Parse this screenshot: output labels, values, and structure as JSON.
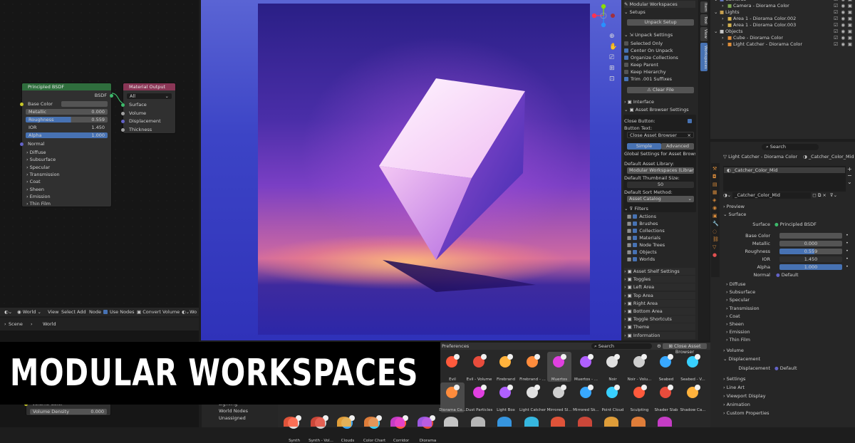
{
  "node_editor": {
    "principled": {
      "title": "Principled BSDF",
      "out": "BSDF",
      "base_color": "Base Color",
      "metallic": "Metallic",
      "metallic_v": "0.000",
      "roughness": "Roughness",
      "roughness_v": "0.559",
      "ior": "IOR",
      "ior_v": "1.450",
      "alpha": "Alpha",
      "alpha_v": "1.000",
      "normal": "Normal",
      "panels": [
        "Diffuse",
        "Subsurface",
        "Specular",
        "Transmission",
        "Coat",
        "Sheen",
        "Emission",
        "Thin Film"
      ]
    },
    "output": {
      "title": "Material Output",
      "target": "All",
      "inputs": [
        "Surface",
        "Volume",
        "Displacement",
        "Thickness"
      ]
    }
  },
  "shader_header": {
    "world": "World",
    "menus": [
      "View",
      "Select",
      "Add",
      "Node"
    ],
    "use_nodes": "Use Nodes",
    "convert": "Convert Volume",
    "wo": "Wo"
  },
  "breadcrumb": {
    "scene": "Scene",
    "world": "World"
  },
  "volume": {
    "color": "Volume Color",
    "density": "Volume Density",
    "density_v": "0.000"
  },
  "world_list": [
    "Lighting",
    "World Nodes",
    "Unassigned"
  ],
  "sidebar": {
    "header": "Modular Workspaces",
    "setups": "Setups",
    "unpack_setup": "Unpack Setup",
    "unpack_settings": "Unpack Settings",
    "unpack_opts": [
      {
        "label": "Selected Only",
        "on": false
      },
      {
        "label": "Center On Unpack",
        "on": true
      },
      {
        "label": "Organize Collections",
        "on": true
      },
      {
        "label": "Keep Parent",
        "on": false
      },
      {
        "label": "Keep Hierarchy",
        "on": false
      },
      {
        "label": "Trim .001 Suffixes",
        "on": true
      }
    ],
    "clear_file": "Clear File",
    "interface": "Interface",
    "asset_browser_settings": "Asset Browser Settings",
    "close_button": "Close Button:",
    "button_text": "Button Text:",
    "button_text_v": "Close Asset Browser",
    "tab_simple": "Simple",
    "tab_advanced": "Advanced",
    "global_settings": "Global Settings for Asset Browser",
    "default_library": "Default Asset Library:",
    "default_library_v": "Modular Workspaces (Library)",
    "thumb_size": "Default Thumbnail Size:",
    "thumb_size_v": "50",
    "sort_method": "Default Sort Method:",
    "sort_method_v": "Asset Catalog",
    "filters": "Filters",
    "filter_items": [
      "Actions",
      "Brushes",
      "Collections",
      "Materials",
      "Node Trees",
      "Objects",
      "Worlds"
    ],
    "sections": [
      "Asset Shelf Settings",
      "Toggles",
      "Left Area",
      "Top Area",
      "Right Area",
      "Bottom Area",
      "Toggle Shortcuts",
      "Theme",
      "Information"
    ]
  },
  "vtabs": [
    "Item",
    "Tool",
    "View",
    "Workspaces"
  ],
  "outliner": {
    "rows": [
      {
        "label": "Cameras",
        "indent": 1
      },
      {
        "label": "Camera - Diorama Color",
        "indent": 2
      },
      {
        "label": "Lights",
        "indent": 1
      },
      {
        "label": "Area 1 - Diorama Color.002",
        "indent": 2
      },
      {
        "label": "Area 1 - Diorama Color.003",
        "indent": 2
      },
      {
        "label": "Objects",
        "indent": 1
      },
      {
        "label": "Cube - Diorama Color",
        "indent": 2
      },
      {
        "label": "Light Catcher - Diorama Color",
        "indent": 2
      }
    ]
  },
  "props": {
    "search": "Search",
    "object": "Light Catcher - Diorama Color",
    "material": "_Catcher_Color_Mid",
    "slot": "_Catcher_Color_Mid",
    "datablock": "_Catcher_Color_Mid",
    "preview": "Preview",
    "surface": "Surface",
    "surface_lbl": "Surface",
    "surface_v": "Principled BSDF",
    "base_color": "Base Color",
    "metallic": "Metallic",
    "metallic_v": "0.000",
    "roughness": "Roughness",
    "roughness_v": "0.559",
    "ior": "IOR",
    "ior_v": "1.450",
    "alpha": "Alpha",
    "alpha_v": "1.000",
    "normal": "Normal",
    "normal_v": "Default",
    "panels": [
      "Diffuse",
      "Subsurface",
      "Specular",
      "Transmission",
      "Coat",
      "Sheen",
      "Emission",
      "Thin Film"
    ],
    "volume": "Volume",
    "displacement": "Displacement",
    "displacement_lbl": "Displacement",
    "displacement_v": "Default",
    "more": [
      "Settings",
      "Line Art",
      "Viewport Display",
      "Animation",
      "Custom Properties"
    ]
  },
  "assets": {
    "prefs": "Preferences",
    "search": "Search",
    "close": "Close Asset Browser",
    "row1": [
      "Evil",
      "Evil - Volume",
      "Firebrand",
      "Firebrand - ...",
      "Muertos",
      "Muertos - ...",
      "Noir",
      "Noir - Volu...",
      "Seabed",
      "Seabed - V..."
    ],
    "row2": [
      "Diorama Co...",
      "Dust Particles",
      "Light Box",
      "Light Catcher",
      "Mirrored Sl...",
      "Mirrored Sk...",
      "Point Cloud",
      "Sculpting",
      "Shader Slab",
      "Shadow Ca..."
    ],
    "row3": [
      "Synth",
      "Synth - Vol...",
      "Clouds",
      "Color Chart",
      "Corridor",
      "Diorama"
    ]
  },
  "banner": {
    "title": "MODULAR WORKSPACES"
  }
}
